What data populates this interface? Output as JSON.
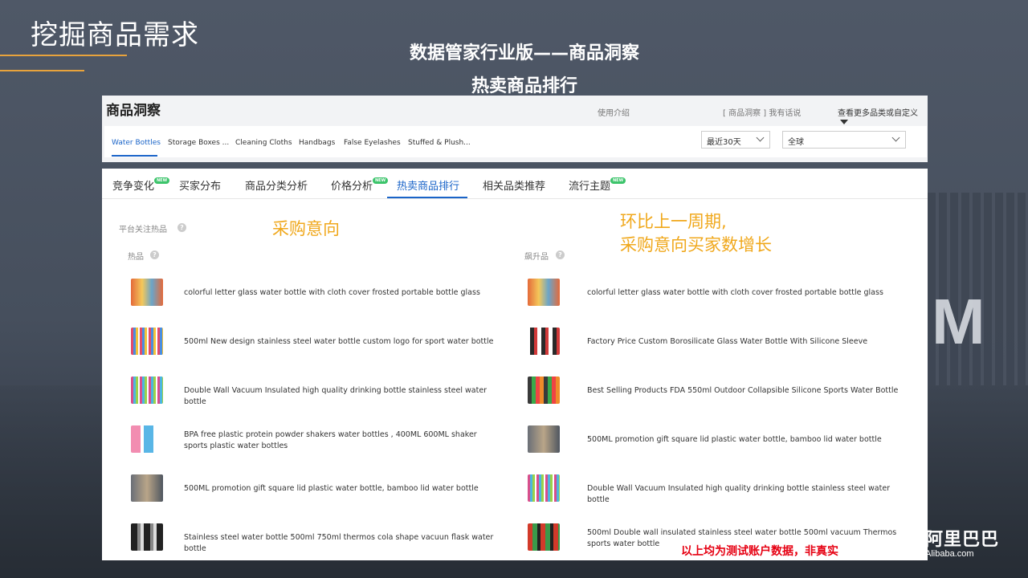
{
  "slide": {
    "title": "挖掘商品需求",
    "subtitle1": "数据管家行业版——商品洞察",
    "subtitle2": "热卖商品排行"
  },
  "top_panel": {
    "title": "商品洞察",
    "help": "使用介绍",
    "feedback": "[ 商品洞察 ] 我有话说",
    "more": "查看更多品类或自定义",
    "categories": [
      "Water Bottles",
      "Storage Boxes ...",
      "Cleaning Cloths",
      "Handbags",
      "False Eyelashes",
      "Stuffed & Plush..."
    ],
    "time_select": "最近30天",
    "region_select": "全球"
  },
  "tabs": [
    "竞争变化",
    "买家分布",
    "商品分类分析",
    "价格分析",
    "热卖商品排行",
    "相关品类推荐",
    "流行主题"
  ],
  "new_badge": "NEW",
  "section_label": "平台关注热品",
  "hot_label": "热品",
  "rising_label": "飙升品",
  "annotations": {
    "left": "采购意向",
    "right_line1": "环比上一周期,",
    "right_line2": "采购意向买家数增长"
  },
  "hot_products": [
    "colorful letter glass water bottle with cloth cover frosted portable bottle glass",
    "500ml New design stainless steel water bottle custom logo for sport water bottle",
    "Double Wall Vacuum Insulated high quality drinking bottle stainless steel water bottle",
    "BPA free plastic protein powder shakers water bottles , 400ML 600ML shaker sports plastic water bottles",
    "500ML promotion gift square lid plastic water bottle, bamboo lid water bottle",
    "Stainless steel water bottle 500ml 750ml thermos cola shape vacuun flask water bottle"
  ],
  "rising_products": [
    "colorful letter glass water bottle with cloth cover frosted portable bottle glass",
    "Factory Price Custom Borosilicate Glass Water Bottle With Silicone Sleeve",
    "Best Selling Products FDA 550ml Outdoor Collapsible Silicone Sports Water Bottle",
    "500ML promotion gift square lid plastic water bottle, bamboo lid water bottle",
    "Double Wall Vacuum Insulated high quality drinking bottle stainless steel water bottle",
    "500ml Double wall insulated stainless steel water bottle 500ml vacuum Thermos sports water bottle"
  ],
  "disclaimer": "以上均为测试账户数据，非真实",
  "logo": {
    "cn": "阿里巴巴",
    "en": "Alibaba.com"
  },
  "colors": {
    "accent_blue": "#1a64c8",
    "annotation": "#f0a81c",
    "disclaimer": "#e60012",
    "title_line": "#e8a33c"
  }
}
